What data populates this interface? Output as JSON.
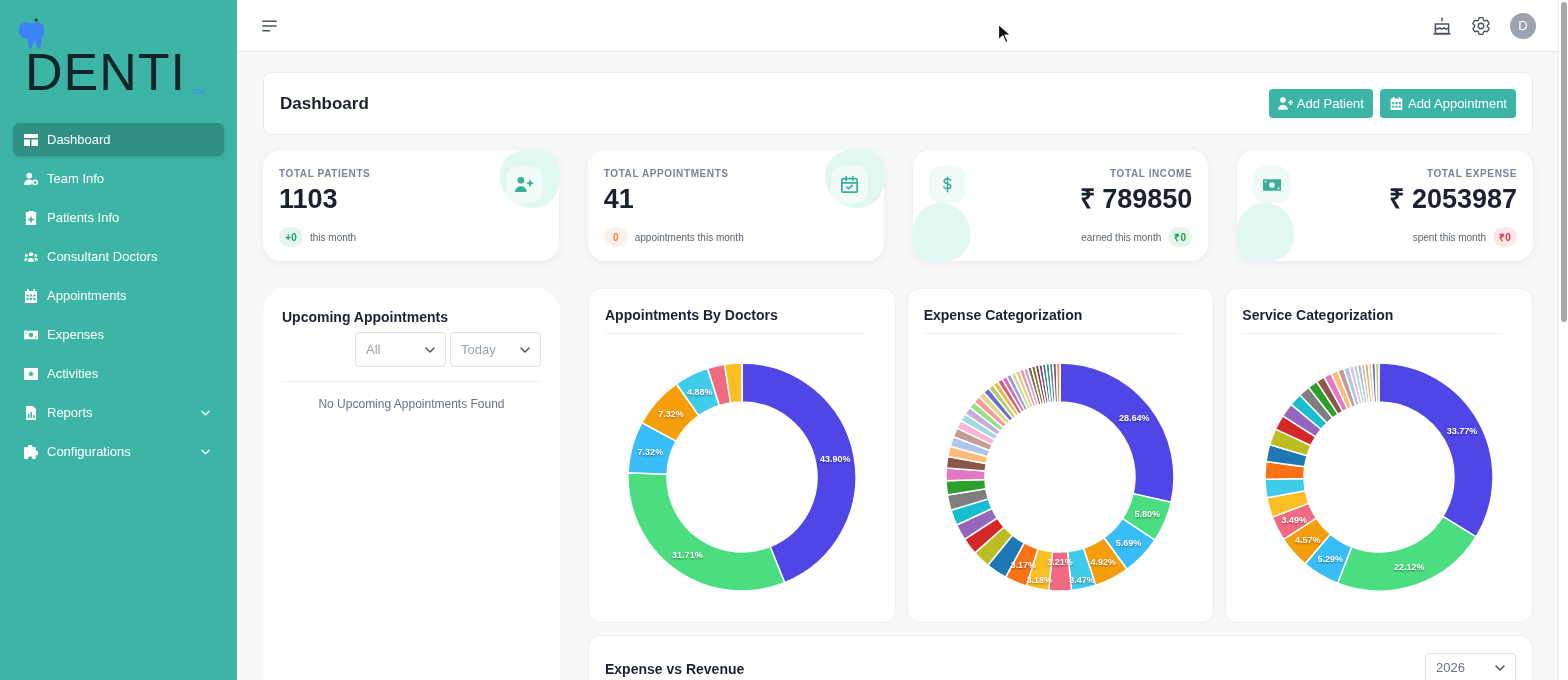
{
  "sidebar": {
    "logo": {
      "wordmark": "DENTI",
      "suffix": "360"
    },
    "items": [
      {
        "label": "Dashboard",
        "kind": "link",
        "selected": true
      },
      {
        "label": "Team Info",
        "kind": "link",
        "selected": false
      },
      {
        "label": "Patients Info",
        "kind": "link",
        "selected": false
      },
      {
        "label": "Consultant Doctors",
        "kind": "link",
        "selected": false
      },
      {
        "label": "Appointments",
        "kind": "link",
        "selected": false
      },
      {
        "label": "Expenses",
        "kind": "link",
        "selected": false
      },
      {
        "label": "Activities",
        "kind": "link",
        "selected": false
      },
      {
        "label": "Reports",
        "kind": "menu",
        "selected": false,
        "expanded": false
      },
      {
        "label": "Configurations",
        "kind": "menu",
        "selected": false,
        "expanded": false
      }
    ]
  },
  "topbar": {
    "avatar": "D"
  },
  "header": {
    "title": "Dashboard",
    "buttons": [
      {
        "label": "Add Patient"
      },
      {
        "label": "Add Appointment"
      }
    ]
  },
  "stats": [
    {
      "kind": "count",
      "label": "TOTAL PATIENTS",
      "value": "1103",
      "badge": {
        "text": "+0",
        "color": "#1f9d6b"
      },
      "note": "this month"
    },
    {
      "kind": "count",
      "label": "TOTAL APPOINTMENTS",
      "value": "41",
      "badge": {
        "text": "0",
        "color": "#e8843f"
      },
      "note": "appointments this month"
    },
    {
      "kind": "amount",
      "label": "TOTAL INCOME",
      "value": "₹ 789850",
      "badge": {
        "text": "₹0",
        "color": "#1f9d55"
      },
      "note": "earned this month"
    },
    {
      "kind": "amount",
      "label": "TOTAL EXPENSE",
      "value": "₹ 2053987",
      "badge": {
        "text": "₹0",
        "color": "#e0323a"
      },
      "note": "spent this month"
    }
  ],
  "upcoming": {
    "title": "Upcoming Appointments",
    "filters": [
      "All",
      "Today"
    ],
    "empty_message": "No Upcoming Appointments Found"
  },
  "charts": [
    {
      "chart_data": {
        "type": "donut",
        "title": "Appointments By Doctors",
        "values": [
          43.9,
          31.71,
          7.32,
          7.32,
          4.88,
          2.44,
          2.44
        ],
        "value_labels": [
          "43.90%",
          "31.71%",
          "7.32%",
          "7.32%",
          "4.88%",
          null,
          null
        ],
        "colors": [
          "#4f46e5",
          "#4ade80",
          "#38bdf8",
          "#f59e0b",
          "#3fcbea",
          "#f16a81",
          "#fbbf24"
        ]
      }
    },
    {
      "chart_data": {
        "type": "donut",
        "title": "Expense Categorization",
        "values": [
          28.64,
          5.8,
          5.69,
          4.92,
          3.47,
          3.21,
          3.18,
          3.17,
          3.0,
          2.5,
          2.4,
          2.3,
          2.2,
          2.2,
          2.0,
          1.8,
          1.6,
          1.5,
          1.4,
          1.3,
          1.2,
          1.1,
          1.1,
          1.0,
          1.0,
          0.9,
          0.9,
          0.8,
          0.75,
          0.75,
          0.7,
          0.7,
          0.65,
          0.65,
          0.6,
          0.6,
          0.55,
          0.55,
          0.5,
          0.5,
          0.5,
          0.5,
          0.5,
          0.5,
          0.5
        ],
        "value_labels": [
          "28.64%",
          "5.80%",
          "5.69%",
          "4.92%",
          "3.47%",
          "3.21%",
          "3.18%",
          "3.17%",
          null,
          null,
          null,
          null,
          null,
          null,
          null,
          null,
          null,
          null,
          null,
          null,
          null,
          null,
          null,
          null,
          null,
          null,
          null,
          null,
          null,
          null,
          null,
          null,
          null,
          null,
          null,
          null,
          null,
          null,
          null,
          null,
          null,
          null,
          null,
          null,
          null
        ],
        "colors": [
          "#4f46e5",
          "#4ade80",
          "#38bdf8",
          "#f59e0b",
          "#3fcbea",
          "#f16a81",
          "#fbbf24",
          "#f97316",
          "#1f77b4",
          "#bcbd22",
          "#d62728",
          "#9467bd",
          "#17becf",
          "#7f7f7f",
          "#2ca02c",
          "#e377c2",
          "#8c564b",
          "#ffbb78",
          "#aec7e8",
          "#c49c94",
          "#f7b6d2",
          "#9edae5",
          "#c5b0d5",
          "#98df8a",
          "#ff9896",
          "#dbdb8d",
          "#6b6ecf",
          "#b5cf6b",
          "#e7ba52",
          "#d6616b",
          "#ce6dbd",
          "#9c9ede",
          "#cedb9c",
          "#e7cb94",
          "#e7969c",
          "#de9ed6",
          "#637939",
          "#8c6d31",
          "#843c39",
          "#7b4173",
          "#3182bd",
          "#31a354",
          "#756bb1",
          "#636363",
          "#fd8d3c"
        ]
      }
    },
    {
      "chart_data": {
        "type": "donut",
        "title": "Service Categorization",
        "values": [
          33.77,
          22.12,
          5.29,
          4.57,
          3.49,
          2.8,
          2.6,
          2.5,
          2.4,
          2.3,
          2.1,
          2.0,
          1.8,
          1.6,
          1.4,
          1.2,
          1.1,
          1.0,
          0.9,
          0.8,
          0.6,
          0.55,
          0.55,
          0.5,
          0.5,
          0.5,
          0.5,
          0.5
        ],
        "value_labels": [
          "33.77%",
          "22.12%",
          "5.29%",
          "4.57%",
          "3.49%",
          null,
          null,
          null,
          null,
          null,
          null,
          null,
          null,
          null,
          null,
          null,
          null,
          null,
          null,
          null,
          null,
          null,
          null,
          null,
          null,
          null,
          null,
          null
        ],
        "colors": [
          "#4f46e5",
          "#4ade80",
          "#38bdf8",
          "#f59e0b",
          "#f16a81",
          "#fbbf24",
          "#3fcbea",
          "#f97316",
          "#1f77b4",
          "#bcbd22",
          "#d62728",
          "#9467bd",
          "#17becf",
          "#7f7f7f",
          "#2ca02c",
          "#8c564b",
          "#e377c2",
          "#ffbb78",
          "#c49c94",
          "#aec7e8",
          "#f7b6d2",
          "#9edae5",
          "#c5b0d5",
          "#98df8a",
          "#ff9896",
          "#dbdb8d",
          "#6b6ecf",
          "#b5cf6b"
        ]
      }
    }
  ],
  "expense_revenue": {
    "title": "Expense vs Revenue",
    "year": "2026"
  }
}
